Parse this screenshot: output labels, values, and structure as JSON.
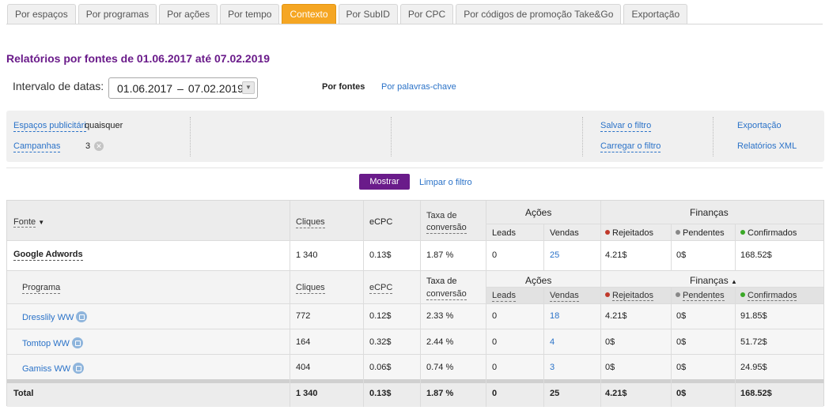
{
  "tabs": [
    {
      "label": "Por espaços",
      "active": false
    },
    {
      "label": "Por programas",
      "active": false
    },
    {
      "label": "Por ações",
      "active": false
    },
    {
      "label": "Por tempo",
      "active": false
    },
    {
      "label": "Contexto",
      "active": true
    },
    {
      "label": "Por SubID",
      "active": false
    },
    {
      "label": "Por CPC",
      "active": false
    },
    {
      "label": "Por códigos de promoção Take&Go",
      "active": false
    },
    {
      "label": "Exportação",
      "active": false
    }
  ],
  "title": "Relatórios por fontes de 01.06.2017 até 07.02.2019",
  "date_range": {
    "label": "Intervalo de datas:",
    "from": "01.06.2017",
    "separator": "–",
    "to": "07.02.2019"
  },
  "report_mode": {
    "active": "Por fontes",
    "alternative": "Por palavras-chave"
  },
  "filters": {
    "spaces_label": "Espaços publicitári",
    "spaces_value": "quaisquer",
    "campaigns_label": "Campanhas",
    "campaigns_count": "3",
    "save_filter": "Salvar o filtro",
    "load_filter": "Carregar o filtro",
    "export": "Exportação",
    "xml_reports": "Relatórios XML"
  },
  "actions": {
    "show": "Mostrar",
    "clear": "Limpar o filtro"
  },
  "table": {
    "header": {
      "source": "Fonte",
      "clicks": "Cliques",
      "ecpc": "eCPC",
      "conv1": "Taxa de",
      "conv2": "conversão",
      "actions_group": "Ações",
      "finance_group": "Finanças",
      "leads": "Leads",
      "sales": "Vendas",
      "rejected": "Rejeitados",
      "pending": "Pendentes",
      "confirmed": "Confirmados"
    },
    "source_row": {
      "name": "Google Adwords",
      "clicks": "1 340",
      "ecpc": "0.13$",
      "conversion": "1.87 %",
      "leads": "0",
      "sales": "25",
      "rejected": "4.21$",
      "pending": "0$",
      "confirmed": "168.52$"
    },
    "sub_header": {
      "program": "Programa",
      "clicks": "Cliques",
      "ecpc": "eCPC",
      "conv1": "Taxa de",
      "conv2": "conversão",
      "actions_group": "Ações",
      "finance_group": "Finanças",
      "leads": "Leads",
      "sales": "Vendas",
      "rejected": "Rejeitados",
      "pending": "Pendentes",
      "confirmed": "Confirmados"
    },
    "programs": [
      {
        "name": "Dresslily WW",
        "clicks": "772",
        "ecpc": "0.12$",
        "conversion": "2.33 %",
        "leads": "0",
        "sales": "18",
        "rejected": "4.21$",
        "pending": "0$",
        "confirmed": "91.85$"
      },
      {
        "name": "Tomtop WW",
        "clicks": "164",
        "ecpc": "0.32$",
        "conversion": "2.44 %",
        "leads": "0",
        "sales": "4",
        "rejected": "0$",
        "pending": "0$",
        "confirmed": "51.72$"
      },
      {
        "name": "Gamiss WW",
        "clicks": "404",
        "ecpc": "0.06$",
        "conversion": "0.74 %",
        "leads": "0",
        "sales": "3",
        "rejected": "0$",
        "pending": "0$",
        "confirmed": "24.95$"
      }
    ],
    "total": {
      "label": "Total",
      "clicks": "1 340",
      "ecpc": "0.13$",
      "conversion": "1.87 %",
      "leads": "0",
      "sales": "25",
      "rejected": "4.21$",
      "pending": "0$",
      "confirmed": "168.52$"
    }
  },
  "colors": {
    "accent_tab": "#f5a623",
    "brand": "#6a1b8a",
    "link": "#2a72c8",
    "rejected_dot": "#c0392b",
    "pending_dot": "#888888",
    "confirmed_dot": "#3aa827"
  }
}
